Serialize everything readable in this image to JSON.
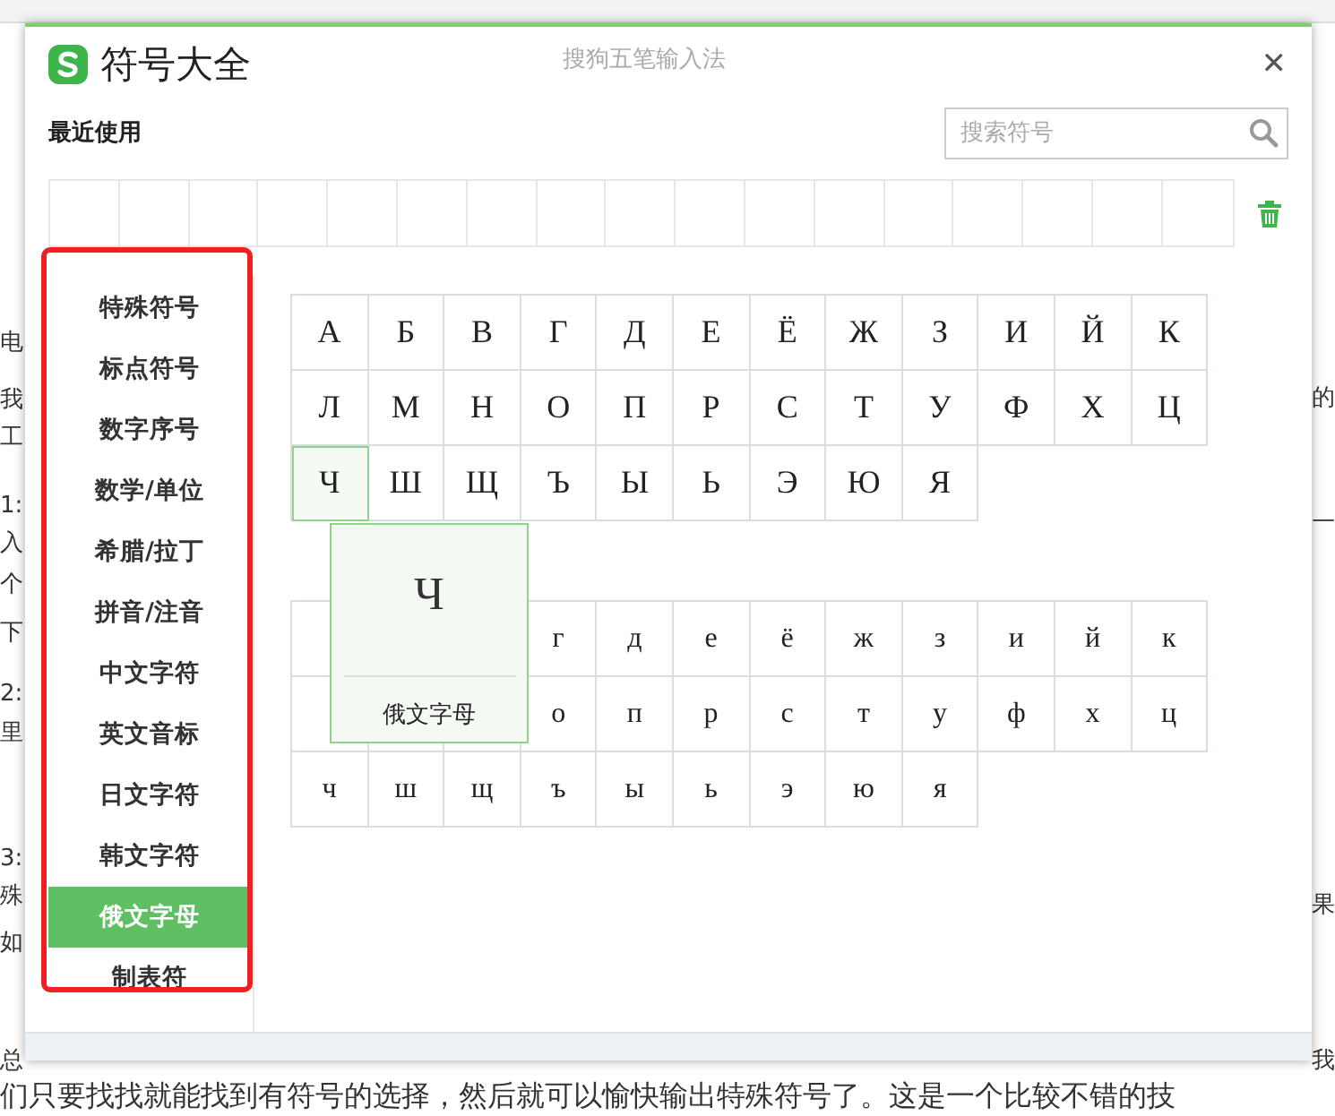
{
  "background_document": {
    "left_fragments": [
      "电",
      "我",
      "工",
      "1:",
      "入",
      "个",
      "下",
      "2:",
      "里",
      "3:",
      "殊",
      "如",
      "总"
    ],
    "right_fragments": [
      "的",
      "—",
      "果",
      "我"
    ],
    "bottom_line": "们只要找找就能找到有符号的选择，然后就可以愉快输出特殊符号了。这是一个比较不错的技"
  },
  "dialog": {
    "title": "符号大全",
    "subtitle": "搜狗五笔输入法",
    "close": "✕",
    "recent": {
      "label": "最近使用",
      "search": {
        "placeholder": "搜索符号"
      }
    },
    "sidebar": {
      "items": [
        {
          "label": "特殊符号",
          "selected": false
        },
        {
          "label": "标点符号",
          "selected": false
        },
        {
          "label": "数字序号",
          "selected": false
        },
        {
          "label": "数学/单位",
          "selected": false
        },
        {
          "label": "希腊/拉丁",
          "selected": false
        },
        {
          "label": "拼音/注音",
          "selected": false
        },
        {
          "label": "中文字符",
          "selected": false
        },
        {
          "label": "英文音标",
          "selected": false
        },
        {
          "label": "日文字符",
          "selected": false
        },
        {
          "label": "韩文字符",
          "selected": false
        },
        {
          "label": "俄文字母",
          "selected": true
        },
        {
          "label": "制表符",
          "selected": false
        }
      ]
    },
    "uppercase": [
      {
        "char": "А",
        "hovered": false
      },
      {
        "char": "Б",
        "hovered": false
      },
      {
        "char": "В",
        "hovered": false
      },
      {
        "char": "Г",
        "hovered": false
      },
      {
        "char": "Д",
        "hovered": false
      },
      {
        "char": "Е",
        "hovered": false
      },
      {
        "char": "Ё",
        "hovered": false
      },
      {
        "char": "Ж",
        "hovered": false
      },
      {
        "char": "З",
        "hovered": false
      },
      {
        "char": "И",
        "hovered": false
      },
      {
        "char": "Й",
        "hovered": false
      },
      {
        "char": "К",
        "hovered": false
      },
      {
        "char": "Л",
        "hovered": false
      },
      {
        "char": "М",
        "hovered": false
      },
      {
        "char": "Н",
        "hovered": false
      },
      {
        "char": "О",
        "hovered": false
      },
      {
        "char": "П",
        "hovered": false
      },
      {
        "char": "Р",
        "hovered": false
      },
      {
        "char": "С",
        "hovered": false
      },
      {
        "char": "Т",
        "hovered": false
      },
      {
        "char": "У",
        "hovered": false
      },
      {
        "char": "Ф",
        "hovered": false
      },
      {
        "char": "Х",
        "hovered": false
      },
      {
        "char": "Ц",
        "hovered": false
      },
      {
        "char": "Ч",
        "hovered": true
      },
      {
        "char": "Ш",
        "hovered": false
      },
      {
        "char": "Щ",
        "hovered": false
      },
      {
        "char": "Ъ",
        "hovered": false
      },
      {
        "char": "Ы",
        "hovered": false
      },
      {
        "char": "Ь",
        "hovered": false
      },
      {
        "char": "Э",
        "hovered": false
      },
      {
        "char": "Ю",
        "hovered": false
      },
      {
        "char": "Я",
        "hovered": false
      }
    ],
    "lowercase": [
      [
        "г",
        "д",
        "е",
        "ё",
        "ж",
        "з",
        "и",
        "й",
        "к"
      ],
      [
        "о",
        "п",
        "р",
        "с",
        "т",
        "у",
        "ф",
        "х",
        "ц"
      ],
      [
        "ч",
        "ш",
        "щ",
        "ъ",
        "ы",
        "ь",
        "э",
        "ю",
        "я"
      ]
    ],
    "tooltip": {
      "symbol": "Ч",
      "label": "俄文字母"
    }
  }
}
